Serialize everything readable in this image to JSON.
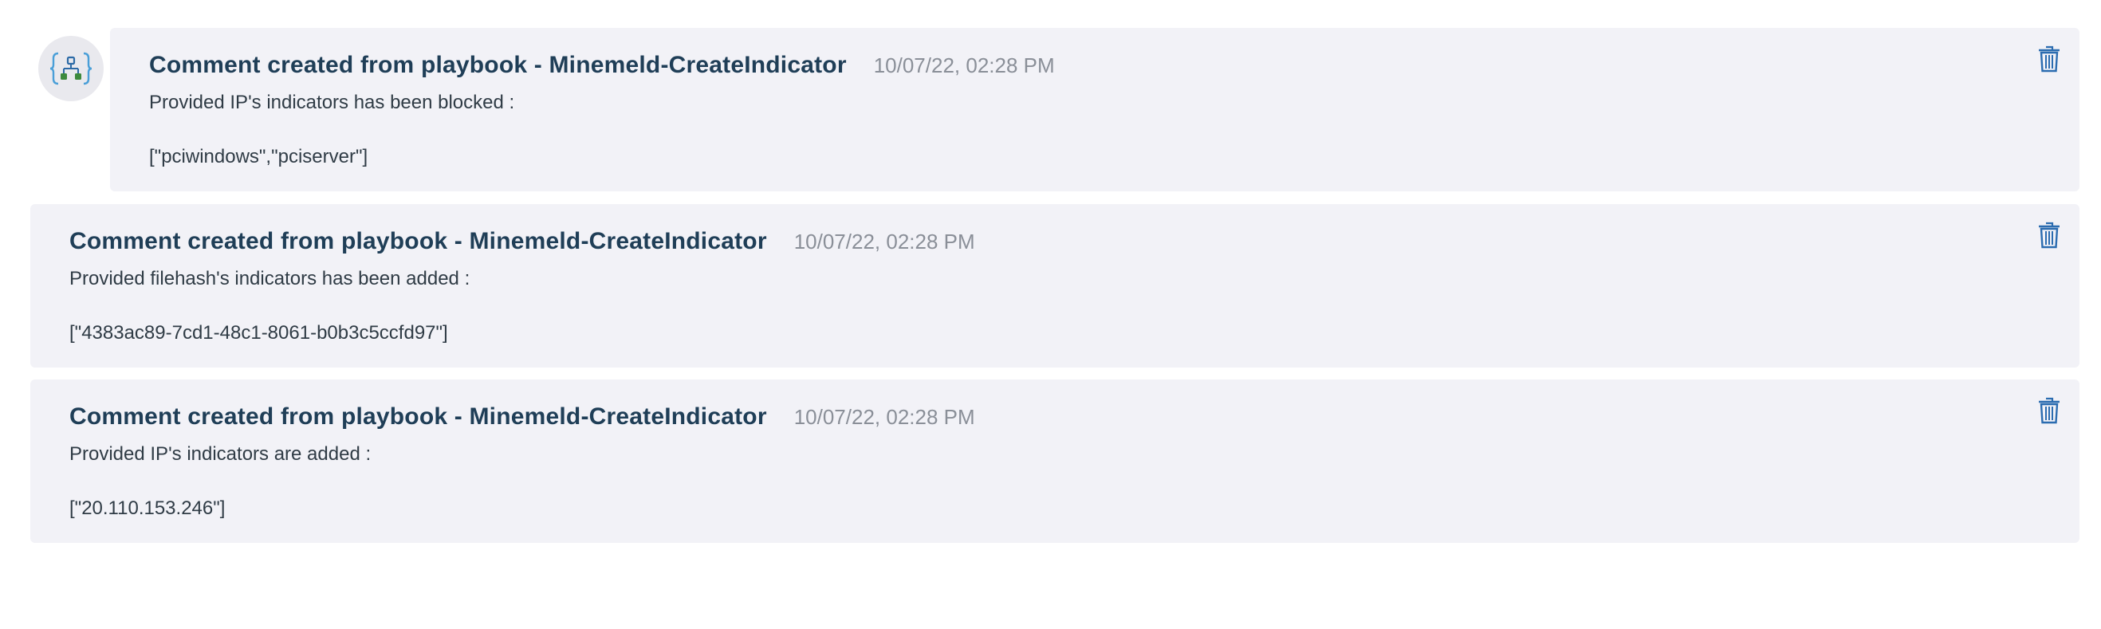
{
  "avatar": {
    "icon": "playbook-workflow-icon",
    "brace_color": "#4a9fd8",
    "node_color": "#3d8a3d"
  },
  "accent_color": "#2b6cb0",
  "comments": [
    {
      "title": "Comment created from playbook - Minemeld-CreateIndicator",
      "timestamp": "10/07/22, 02:28 PM",
      "message": "Provided IP's indicators has been blocked :",
      "payload": "[\"pciwindows\",\"pciserver\"]",
      "delete_icon": "trash-icon"
    },
    {
      "title": "Comment created from playbook - Minemeld-CreateIndicator",
      "timestamp": "10/07/22, 02:28 PM",
      "message": "Provided filehash's indicators has been added :",
      "payload": "[\"4383ac89-7cd1-48c1-8061-b0b3c5ccfd97\"]",
      "delete_icon": "trash-icon"
    },
    {
      "title": "Comment created from playbook - Minemeld-CreateIndicator",
      "timestamp": "10/07/22, 02:28 PM",
      "message": "Provided IP's indicators are added :",
      "payload": "[\"20.110.153.246\"]",
      "delete_icon": "trash-icon"
    }
  ]
}
